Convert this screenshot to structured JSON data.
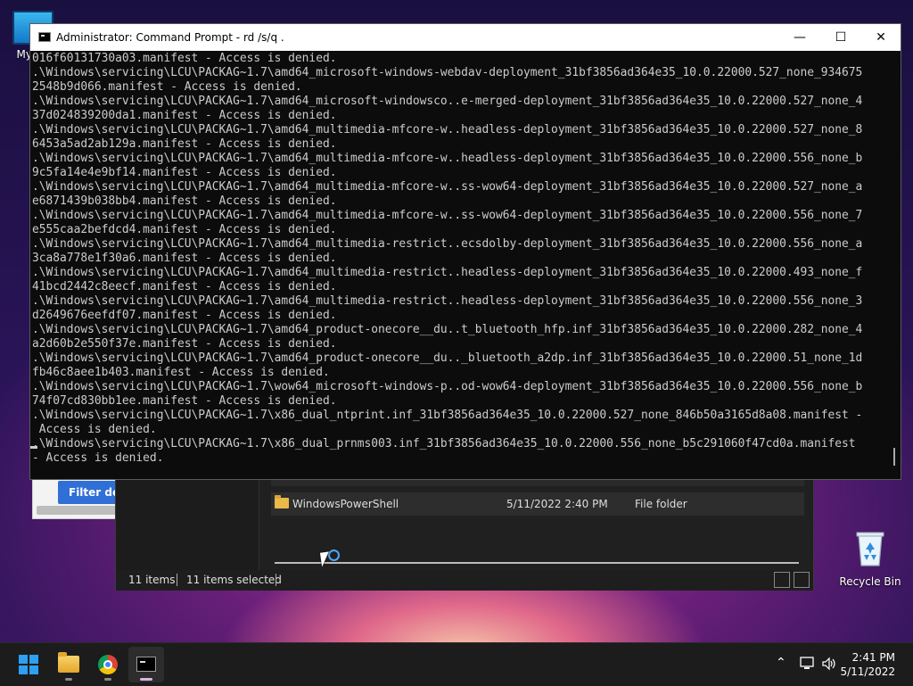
{
  "desktop": {
    "this_pc_label": "My Co",
    "recycle_bin_label": "Recycle Bin"
  },
  "background_window": {
    "filter_button_label": "Filter defi"
  },
  "explorer": {
    "row_partial": "WindowsPowerShell",
    "row": {
      "name": "WindowsPowerShell",
      "date": "5/11/2022 2:40 PM",
      "type": "File folder"
    },
    "status_items": "11 items",
    "status_selected": "11 items selected"
  },
  "cmd": {
    "title": "Administrator: Command Prompt - rd  /s/q .",
    "lines": [
      "016f60131730a03.manifest - Access is denied.",
      ".\\Windows\\servicing\\LCU\\PACKAG~1.7\\amd64_microsoft-windows-webdav-deployment_31bf3856ad364e35_10.0.22000.527_none_934675",
      "2548b9d066.manifest - Access is denied.",
      ".\\Windows\\servicing\\LCU\\PACKAG~1.7\\amd64_microsoft-windowsco..e-merged-deployment_31bf3856ad364e35_10.0.22000.527_none_4",
      "37d024839200da1.manifest - Access is denied.",
      ".\\Windows\\servicing\\LCU\\PACKAG~1.7\\amd64_multimedia-mfcore-w..headless-deployment_31bf3856ad364e35_10.0.22000.527_none_8",
      "6453a5ad2ab129a.manifest - Access is denied.",
      ".\\Windows\\servicing\\LCU\\PACKAG~1.7\\amd64_multimedia-mfcore-w..headless-deployment_31bf3856ad364e35_10.0.22000.556_none_b",
      "9c5fa14e4e9bf14.manifest - Access is denied.",
      ".\\Windows\\servicing\\LCU\\PACKAG~1.7\\amd64_multimedia-mfcore-w..ss-wow64-deployment_31bf3856ad364e35_10.0.22000.527_none_a",
      "e6871439b038bb4.manifest - Access is denied.",
      ".\\Windows\\servicing\\LCU\\PACKAG~1.7\\amd64_multimedia-mfcore-w..ss-wow64-deployment_31bf3856ad364e35_10.0.22000.556_none_7",
      "e555caa2befdcd4.manifest - Access is denied.",
      ".\\Windows\\servicing\\LCU\\PACKAG~1.7\\amd64_multimedia-restrict..ecsdolby-deployment_31bf3856ad364e35_10.0.22000.556_none_a",
      "3ca8a778e1f30a6.manifest - Access is denied.",
      ".\\Windows\\servicing\\LCU\\PACKAG~1.7\\amd64_multimedia-restrict..headless-deployment_31bf3856ad364e35_10.0.22000.493_none_f",
      "41bcd2442c8eecf.manifest - Access is denied.",
      ".\\Windows\\servicing\\LCU\\PACKAG~1.7\\amd64_multimedia-restrict..headless-deployment_31bf3856ad364e35_10.0.22000.556_none_3",
      "d2649676eefdf07.manifest - Access is denied.",
      ".\\Windows\\servicing\\LCU\\PACKAG~1.7\\amd64_product-onecore__du..t_bluetooth_hfp.inf_31bf3856ad364e35_10.0.22000.282_none_4",
      "a2d60b2e550f37e.manifest - Access is denied.",
      ".\\Windows\\servicing\\LCU\\PACKAG~1.7\\amd64_product-onecore__du.._bluetooth_a2dp.inf_31bf3856ad364e35_10.0.22000.51_none_1d",
      "fb46c8aee1b403.manifest - Access is denied.",
      ".\\Windows\\servicing\\LCU\\PACKAG~1.7\\wow64_microsoft-windows-p..od-wow64-deployment_31bf3856ad364e35_10.0.22000.556_none_b",
      "74f07cd830bb1ee.manifest - Access is denied.",
      ".\\Windows\\servicing\\LCU\\PACKAG~1.7\\x86_dual_ntprint.inf_31bf3856ad364e35_10.0.22000.527_none_846b50a3165d8a08.manifest -",
      " Access is denied.",
      ".\\Windows\\servicing\\LCU\\PACKAG~1.7\\x86_dual_prnms003.inf_31bf3856ad364e35_10.0.22000.556_none_b5c291060f47cd0a.manifest",
      "- Access is denied."
    ]
  },
  "taskbar": {
    "apps": [
      {
        "name": "start",
        "icon": "windows-start-icon"
      },
      {
        "name": "file-explorer",
        "icon": "folder-icon"
      },
      {
        "name": "chrome",
        "icon": "chrome-icon"
      },
      {
        "name": "command-prompt",
        "icon": "terminal-icon",
        "active": true
      }
    ],
    "time": "2:41 PM",
    "date": "5/11/2022"
  }
}
